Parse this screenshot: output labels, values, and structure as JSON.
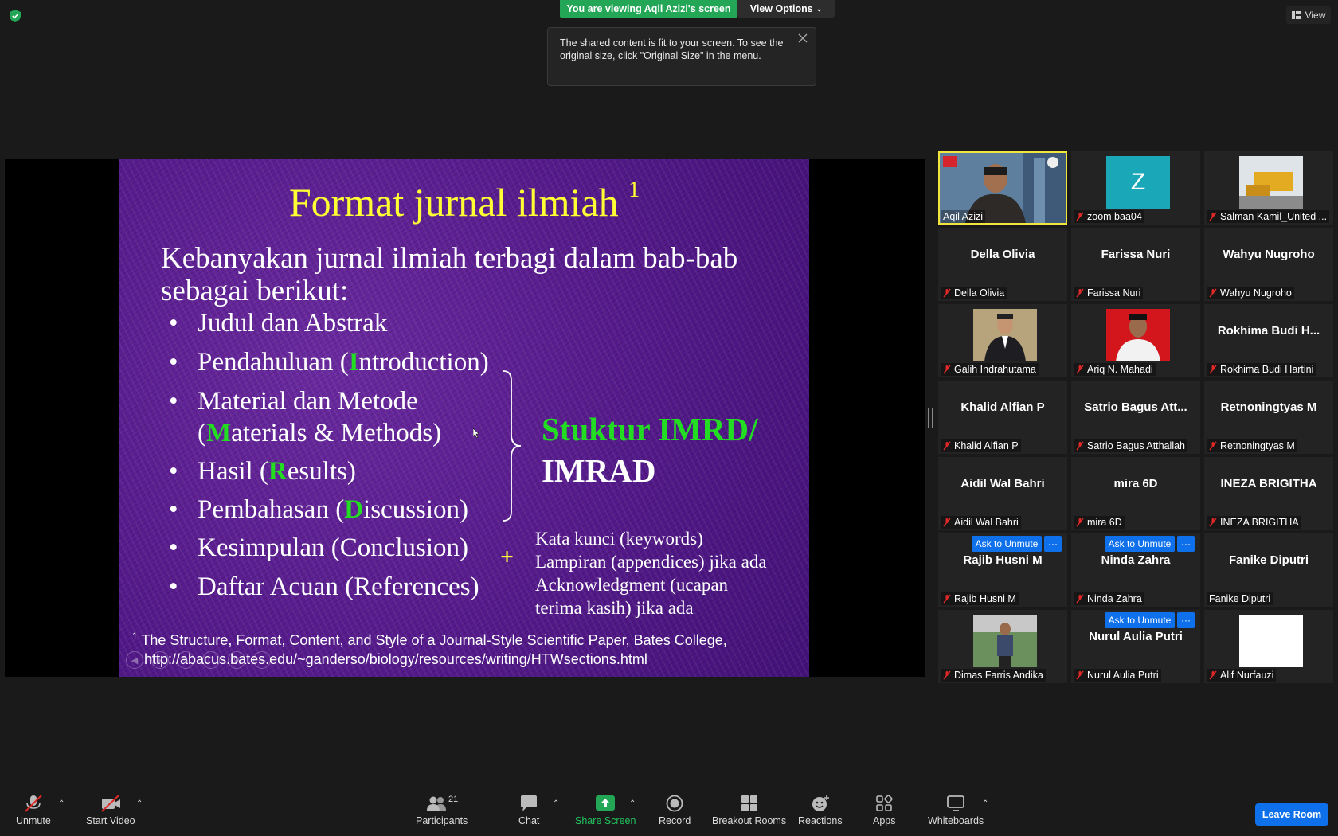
{
  "banner": {
    "viewing_text": "You are viewing Aqil Azizi's screen",
    "view_options_label": "View Options"
  },
  "tooltip": {
    "text": "The shared content is fit to your screen. To see the original size, click \"Original Size\" in the menu."
  },
  "view_button": {
    "label": "View"
  },
  "slide": {
    "title": "Format jurnal ilmiah",
    "title_sup": "1",
    "intro": "Kebanyakan jurnal ilmiah terbagi dalam bab-bab sebagai berikut:",
    "bullets": {
      "b1": "Judul dan Abstrak",
      "b2_pre": "Pendahuluan (",
      "b2_hl": "I",
      "b2_post": "ntroduction)",
      "b3_line1": "Material dan Metode",
      "b3_pre": "(",
      "b3_hl": "M",
      "b3_post": "aterials & Methods)",
      "b4_pre": "Hasil (",
      "b4_hl": "R",
      "b4_post": "esults)",
      "b5_pre": "Pembahasan (",
      "b5_hl": "D",
      "b5_post": "iscussion)",
      "b6": "Kesimpulan (Conclusion)",
      "b7": "Daftar Acuan (References)"
    },
    "imrd_green": "Stuktur IMRD/",
    "imrd_white": "IMRAD",
    "plus": "+",
    "extras": [
      "Kata kunci (keywords)",
      "Lampiran (appendices) jika ada",
      "Acknowledgment (ucapan",
      "terima kasih) jika ada"
    ],
    "footnote_sup": "1",
    "footnote_line1": "The Structure, Format, Content, and Style of a Journal-Style Scientific Paper, Bates College,",
    "footnote_line2": "http://abacus.bates.edu/~ganderso/biology/resources/writing/HTWsections.html"
  },
  "gallery": {
    "ask_label": "Ask to Unmute",
    "more_label": "···",
    "tiles": [
      {
        "label": "Aqil Azizi",
        "active_speaker": true
      },
      {
        "label": "zoom baa04",
        "initial": "Z"
      },
      {
        "label": "Salman Kamil_United ..."
      },
      {
        "name": "Della Olivia",
        "label": "Della Olivia"
      },
      {
        "name": "Farissa Nuri",
        "label": "Farissa Nuri"
      },
      {
        "name": "Wahyu Nugroho",
        "label": "Wahyu Nugroho"
      },
      {
        "label": "Galih Indrahutama"
      },
      {
        "label": "Ariq N. Mahadi"
      },
      {
        "name": "Rokhima Budi H...",
        "label": "Rokhima Budi Hartini"
      },
      {
        "name": "Khalid Alfian P",
        "label": "Khalid Alfian P"
      },
      {
        "name": "Satrio Bagus Att...",
        "label": "Satrio Bagus Atthallah"
      },
      {
        "name": "Retnoningtyas M",
        "label": "Retnoningtyas M"
      },
      {
        "name": "Aidil Wal Bahri",
        "label": "Aidil Wal Bahri"
      },
      {
        "name": "mira 6D",
        "label": "mira 6D"
      },
      {
        "name": "INEZA BRIGITHA",
        "label": "INEZA BRIGITHA"
      },
      {
        "name": "Rajib Husni M",
        "label": "Rajib Husni M"
      },
      {
        "name": "Ninda Zahra",
        "label": "Ninda Zahra"
      },
      {
        "name": "Fanike Diputri",
        "label": "Fanike Diputri"
      },
      {
        "label": "Dimas Farris Andika"
      },
      {
        "name": "Nurul Aulia Putri",
        "label": "Nurul Aulia Putri"
      },
      {
        "label": "Alif Nurfauzi"
      }
    ]
  },
  "toolbar": {
    "unmute": "Unmute",
    "start_video": "Start Video",
    "participants": "Participants",
    "participants_count": "21",
    "chat": "Chat",
    "share_screen": "Share Screen",
    "record": "Record",
    "breakout_rooms": "Breakout Rooms",
    "reactions": "Reactions",
    "apps": "Apps",
    "whiteboards": "Whiteboards",
    "leave_room": "Leave Room"
  },
  "colors": {
    "share_green": "#23a757",
    "accent_blue": "#0e71eb",
    "muted_red": "#e02828",
    "slide_yellow": "#ffff33",
    "slide_green": "#22dd22"
  }
}
